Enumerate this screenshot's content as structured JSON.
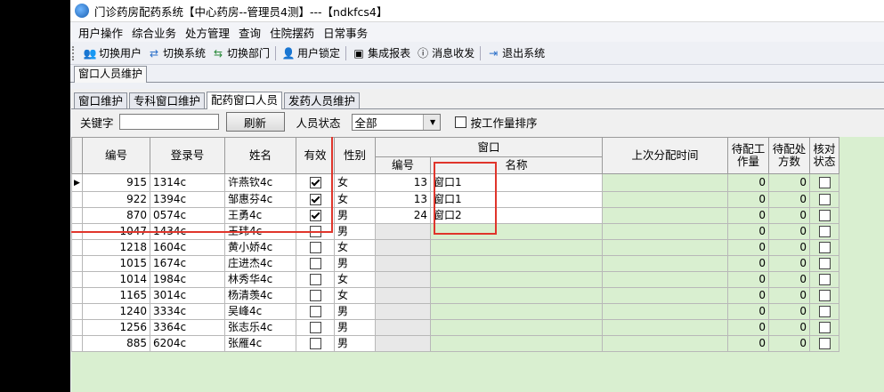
{
  "window": {
    "title": "门诊药房配药系统【中心药房--管理员4测】---【ndkfcs4】"
  },
  "menubar": [
    "用户操作",
    "综合业务",
    "处方管理",
    "查询",
    "住院摆药",
    "日常事务"
  ],
  "toolbar": [
    {
      "label": "切换用户",
      "icon": "users-icon"
    },
    {
      "label": "切换系统",
      "icon": "switch-system-icon"
    },
    {
      "label": "切换部门",
      "icon": "switch-department-icon"
    },
    {
      "label": "用户锁定",
      "icon": "user-lock-icon"
    },
    {
      "label": "集成报表",
      "icon": "report-icon"
    },
    {
      "label": "消息收发",
      "icon": "message-icon"
    },
    {
      "label": "退出系统",
      "icon": "exit-icon"
    }
  ],
  "outer_tab": "窗口人员维护",
  "inner_tabs": [
    "窗口维护",
    "专科窗口维护",
    "配药窗口人员",
    "发药人员维护"
  ],
  "filter": {
    "keyword_label": "关键字",
    "keyword_value": "",
    "refresh_label": "刷新",
    "status_label": "人员状态",
    "status_value": "全部",
    "sort_label": "按工作量排序"
  },
  "grid": {
    "headers": {
      "id": "编号",
      "login": "登录号",
      "name": "姓名",
      "valid": "有效",
      "gender": "性别",
      "window_group": "窗口",
      "window_id": "编号",
      "window_name": "名称",
      "last_time": "上次分配时间",
      "pending_work_1": "待配工",
      "pending_work_2": "作量",
      "pending_rx_1": "待配处",
      "pending_rx_2": "方数",
      "check_1": "核对",
      "check_2": "状态"
    },
    "rows": [
      {
        "id": "915",
        "login": "1314c",
        "name": "许燕钦4c",
        "valid": true,
        "gender": "女",
        "win_id": "13",
        "win_name": "窗口1",
        "last": "",
        "pw": "0",
        "pr": "0",
        "check": false,
        "current": true
      },
      {
        "id": "922",
        "login": "1394c",
        "name": "邹惠芬4c",
        "valid": true,
        "gender": "女",
        "win_id": "13",
        "win_name": "窗口1",
        "last": "",
        "pw": "0",
        "pr": "0",
        "check": false
      },
      {
        "id": "870",
        "login": "0574c",
        "name": "王勇4c",
        "valid": true,
        "gender": "男",
        "win_id": "24",
        "win_name": "窗口2",
        "last": "",
        "pw": "0",
        "pr": "0",
        "check": false
      },
      {
        "id": "1047",
        "login": "1434c",
        "name": "王玮4c",
        "valid": false,
        "gender": "男",
        "win_id": "",
        "win_name": "",
        "last": "",
        "pw": "0",
        "pr": "0",
        "check": false
      },
      {
        "id": "1218",
        "login": "1604c",
        "name": "黄小娇4c",
        "valid": false,
        "gender": "女",
        "win_id": "",
        "win_name": "",
        "last": "",
        "pw": "0",
        "pr": "0",
        "check": false
      },
      {
        "id": "1015",
        "login": "1674c",
        "name": "庄进杰4c",
        "valid": false,
        "gender": "男",
        "win_id": "",
        "win_name": "",
        "last": "",
        "pw": "0",
        "pr": "0",
        "check": false
      },
      {
        "id": "1014",
        "login": "1984c",
        "name": "林秀华4c",
        "valid": false,
        "gender": "女",
        "win_id": "",
        "win_name": "",
        "last": "",
        "pw": "0",
        "pr": "0",
        "check": false
      },
      {
        "id": "1165",
        "login": "3014c",
        "name": "杨清羡4c",
        "valid": false,
        "gender": "女",
        "win_id": "",
        "win_name": "",
        "last": "",
        "pw": "0",
        "pr": "0",
        "check": false
      },
      {
        "id": "1240",
        "login": "3334c",
        "name": "吴峰4c",
        "valid": false,
        "gender": "男",
        "win_id": "",
        "win_name": "",
        "last": "",
        "pw": "0",
        "pr": "0",
        "check": false
      },
      {
        "id": "1256",
        "login": "3364c",
        "name": "张志乐4c",
        "valid": false,
        "gender": "男",
        "win_id": "",
        "win_name": "",
        "last": "",
        "pw": "0",
        "pr": "0",
        "check": false
      },
      {
        "id": "885",
        "login": "6204c",
        "name": "张雁4c",
        "valid": false,
        "gender": "男",
        "win_id": "",
        "win_name": "",
        "last": "",
        "pw": "0",
        "pr": "0",
        "check": false
      }
    ]
  },
  "colors": {
    "highlight_box": "#e0352b",
    "grid_background": "#d9efd0"
  }
}
